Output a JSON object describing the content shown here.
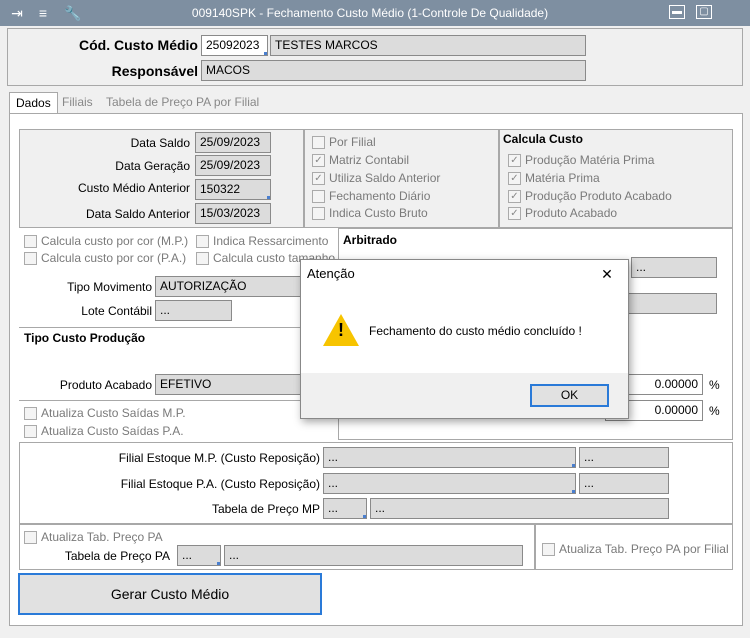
{
  "window": {
    "title": "009140SPK - Fechamento Custo Médio (1-Controle De Qualidade)",
    "minimize": "▬",
    "maximize": "▢",
    "toolbar_icons": [
      "export-icon",
      "traffic-light-icon",
      "wrench-icon"
    ]
  },
  "header": {
    "cod_label": "Cód. Custo Médio",
    "cod_value": "25092023",
    "cod_desc": "TESTES MARCOS",
    "resp_label": "Responsável",
    "resp_value": "MACOS"
  },
  "tabs": [
    "Dados",
    "Filiais",
    "Tabela de Preço PA por Filial"
  ],
  "dates": {
    "data_saldo_label": "Data Saldo",
    "data_saldo": "25/09/2023",
    "data_geracao_label": "Data Geração",
    "data_geracao": "25/09/2023",
    "custo_medio_anterior_label": "Custo Médio Anterior",
    "custo_medio_anterior": "150322",
    "data_saldo_anterior_label": "Data Saldo Anterior",
    "data_saldo_anterior": "15/03/2023"
  },
  "options": {
    "por_filial": "Por Filial",
    "matriz_contabil": "Matriz Contabil",
    "utiliza_saldo_anterior": "Utiliza Saldo Anterior",
    "fechamento_diario": "Fechamento Diário",
    "indica_custo_bruto": "Indica Custo Bruto"
  },
  "calcula_custo": {
    "title": "Calcula Custo",
    "producao_materia_prima": "Produção Matéria Prima",
    "materia_prima": "Matéria Prima",
    "producao_produto_acabado": "Produção Produto Acabado",
    "produto_acabado": "Produto Acabado"
  },
  "cor": {
    "mp": "Calcula custo por cor (M.P.)",
    "pa": "Calcula custo por cor (P.A.)",
    "ressarcimento": "Indica Ressarcimento",
    "tamanho": "Calcula custo tamanho"
  },
  "movimento": {
    "tipo_label": "Tipo Movimento",
    "tipo_value": "AUTORIZAÇÃO",
    "lote_label": "Lote Contábil",
    "lote_value": "..."
  },
  "arbitrado": {
    "title": "Arbitrado",
    "field1": "...",
    "pct1": "0.00000",
    "pct2": "0.00000",
    "pct_sign": "%"
  },
  "producao": {
    "title": "Tipo Custo Produção",
    "produto_acabado_label": "Produto Acabado",
    "produto_acabado_value": "EFETIVO"
  },
  "saidas": {
    "mp": "Atualiza Custo Saídas M.P.",
    "pa": "Atualiza Custo Saídas P.A."
  },
  "filiais": {
    "mp_label": "Filial Estoque M.P. (Custo Reposição)",
    "mp_value": "...",
    "mp_desc": "...",
    "pa_label": "Filial Estoque P.A. (Custo Reposição)",
    "pa_value": "...",
    "pa_desc": "...",
    "tab_mp_label": "Tabela de Preço MP",
    "tab_mp_value": "...",
    "tab_mp_desc": "..."
  },
  "tab_pa": {
    "atualiza": "Atualiza Tab. Preço PA",
    "label": "Tabela de Preço PA",
    "value": "...",
    "desc": "...",
    "por_filial": "Atualiza Tab. Preço PA por Filial"
  },
  "gerar_button": "Gerar Custo Médio",
  "dialog": {
    "title": "Atenção",
    "close": "✕",
    "message": "Fechamento do custo médio concluído !",
    "ok": "OK"
  }
}
